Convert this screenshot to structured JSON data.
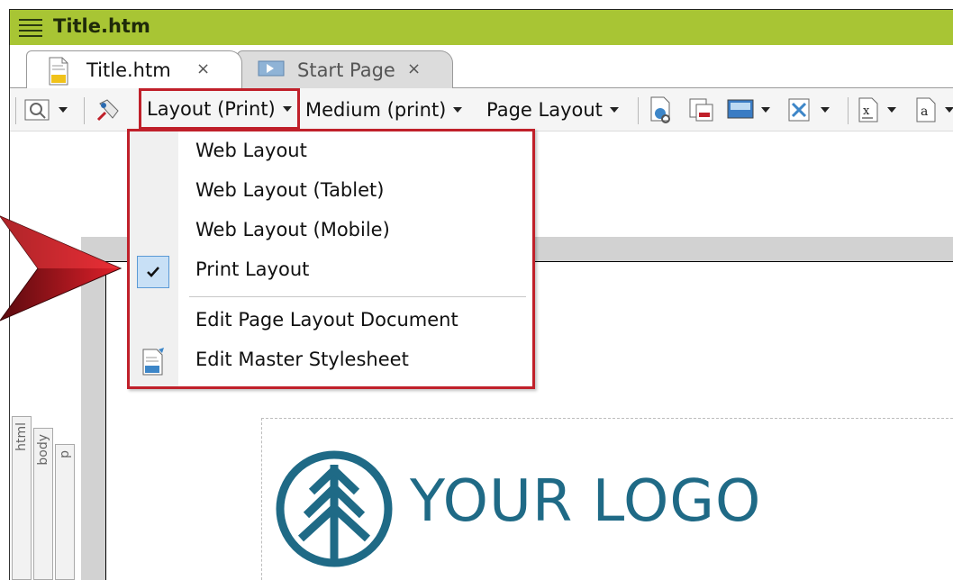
{
  "window": {
    "title": "Title.htm"
  },
  "tabs": [
    {
      "label": "Title.htm",
      "close": "×",
      "active": true
    },
    {
      "label": "Start Page",
      "close": "×",
      "active": false
    }
  ],
  "toolbar": {
    "layout_dropdown": "Layout (Print)",
    "medium_dropdown": "Medium (print)",
    "page_layout_dropdown": "Page Layout"
  },
  "layout_menu": {
    "items": [
      {
        "label": "Web Layout",
        "checked": false
      },
      {
        "label": "Web Layout (Tablet)",
        "checked": false
      },
      {
        "label": "Web Layout (Mobile)",
        "checked": false
      },
      {
        "label": "Print Layout",
        "checked": true
      },
      {
        "label": "Edit Page Layout Document",
        "checked": false
      },
      {
        "label": "Edit Master Stylesheet",
        "checked": false,
        "icon": "stylesheet-icon"
      }
    ]
  },
  "structure_bar": {
    "tags": [
      "html",
      "body",
      "p"
    ]
  },
  "document": {
    "logo_text": "YOUR LOGO"
  },
  "colors": {
    "title_bar": "#a8c534",
    "highlight_border": "#c0202a",
    "logo": "#1f6a86",
    "check_bg": "#c8e0f6"
  }
}
